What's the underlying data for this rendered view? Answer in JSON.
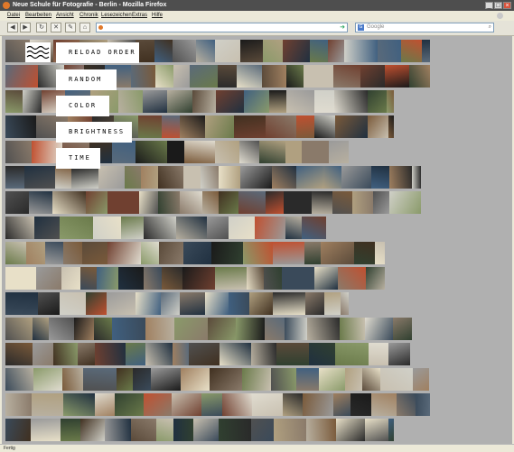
{
  "window": {
    "title": "Neue Schule für Fotografie - Berlin - Mozilla Firefox",
    "minimize": "_",
    "maximize": "□",
    "close": "×"
  },
  "menu": [
    "Datei",
    "Bearbeiten",
    "Ansicht",
    "Chronik",
    "Lesezeichen",
    "Extras",
    "Hilfe"
  ],
  "toolbar": {
    "back": "◀",
    "forward": "▶",
    "reload": "↻",
    "stop": "✕",
    "tools": "✎",
    "home": "⌂"
  },
  "address_bar": {
    "value": "",
    "go": "➜"
  },
  "search_bar": {
    "placeholder": "Google",
    "engine_icon": "G",
    "search_icon": "⌕"
  },
  "controls": [
    {
      "label": "RELOAD ORDER"
    },
    {
      "label": "RANDOM"
    },
    {
      "label": "COLOR"
    },
    {
      "label": "BRIGHTNESS"
    },
    {
      "label": "TIME"
    }
  ],
  "colors": {
    "canvas": "#b0b0b0",
    "titlebar": "#4e4e4e",
    "chrome": "#ece9d8"
  },
  "status": "Fertig"
}
